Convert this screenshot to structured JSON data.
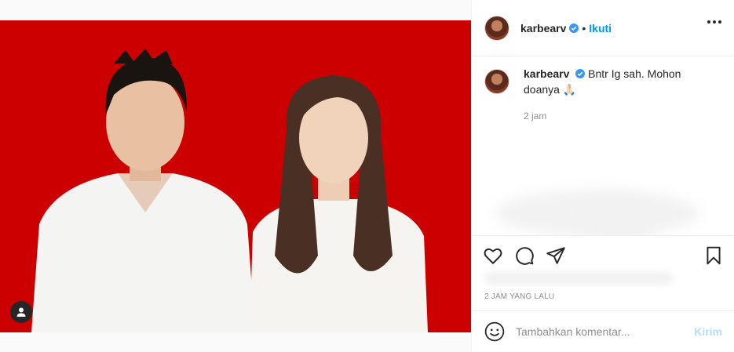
{
  "post": {
    "author": "karbearv",
    "follow_separator": "•",
    "follow_label": "Ikuti",
    "caption": {
      "username": "karbearv",
      "text": "Bntr Ig sah. Mohon doanya 🙏🏻",
      "time": "2 jam"
    },
    "timestamp": "2 JAM YANG LALU"
  },
  "comment_input": {
    "placeholder": "Tambahkan komentar...",
    "value": "",
    "post_label": "Kirim"
  },
  "icons": {
    "more": "more-options-icon",
    "verified": "verified-badge-icon",
    "like": "heart-icon",
    "comment": "comment-icon",
    "share": "paper-plane-icon",
    "save": "bookmark-icon",
    "emoji": "smiley-icon",
    "tag": "user-tag-icon"
  },
  "colors": {
    "accent": "#0095f6",
    "photo_background": "#cc0000",
    "muted_text": "#8e8e8e"
  }
}
